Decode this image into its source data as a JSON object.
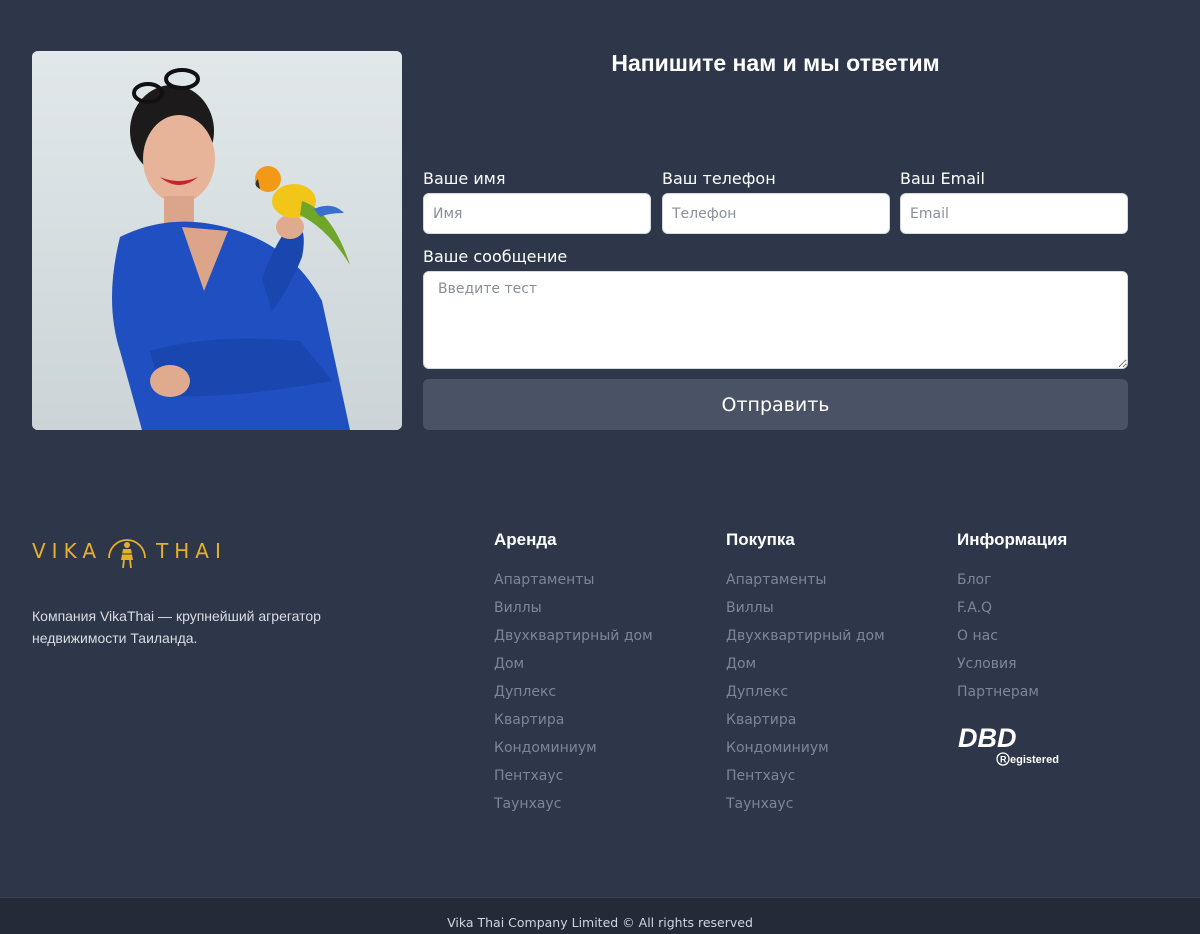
{
  "contact": {
    "title": "Напишите нам и мы ответим",
    "name_label": "Ваше имя",
    "name_placeholder": "Имя",
    "phone_label": "Ваш телефон",
    "phone_placeholder": "Телефон",
    "email_label": "Ваш Email",
    "email_placeholder": "Email",
    "message_label": "Ваше сообщение",
    "message_placeholder": "Введите тест",
    "submit_label": "Отправить"
  },
  "footer": {
    "logo_left": "VIKA",
    "logo_right": "THAI",
    "about": "Компания VikaThai — крупнейший агрегатор недвижимости Таиланда.",
    "columns": [
      {
        "title": "Аренда",
        "items": [
          "Апартаменты",
          "Виллы",
          "Двухквартирный дом",
          "Дом",
          "Дуплекс",
          "Квартира",
          "Кондоминиум",
          "Пентхаус",
          "Таунхаус"
        ]
      },
      {
        "title": "Покупка",
        "items": [
          "Апартаменты",
          "Виллы",
          "Двухквартирный дом",
          "Дом",
          "Дуплекс",
          "Квартира",
          "Кондоминиум",
          "Пентхаус",
          "Таунхаус"
        ]
      },
      {
        "title": "Информация",
        "items": [
          "Блог",
          "F.A.Q",
          "О нас",
          "Условия",
          "Партнерам"
        ]
      }
    ],
    "badge_main": "DBD",
    "badge_sub": "Registered",
    "copyright": "Vika Thai Company Limited © All rights reserved"
  },
  "colors": {
    "background": "#2e3649",
    "button": "#4a5366",
    "logo_gold": "#e6b12a",
    "link_muted": "#7d8597",
    "bottom_bar": "#242a38"
  },
  "icons": [
    "vika-thai-emblem-icon",
    "dbd-registered-logo"
  ]
}
